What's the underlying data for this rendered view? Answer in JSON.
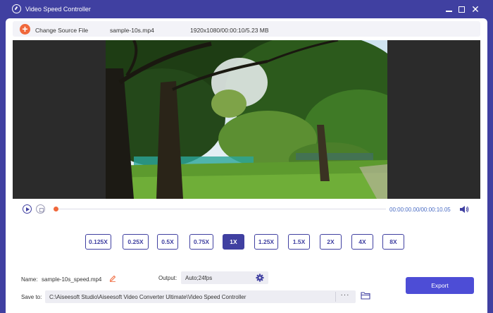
{
  "window": {
    "title": "Video Speed Controller",
    "icons": {
      "app": "speedometer-icon",
      "minimize": "minimize-icon",
      "maximize": "maximize-icon",
      "close": "close-icon"
    },
    "close_glyph": "✕"
  },
  "toolbar": {
    "add_glyph": "+",
    "change_source_label": "Change Source File",
    "file_name": "sample-10s.mp4",
    "file_info": "1920x1080/00:00:10/5.23 MB"
  },
  "player": {
    "time": "00:00:00.00/00:00:10.05",
    "progress": 0,
    "icons": {
      "play": "play-icon",
      "stop": "stop-icon",
      "volume": "volume-icon"
    }
  },
  "speeds": {
    "options": [
      "0.125X",
      "0.25X",
      "0.5X",
      "0.75X",
      "1X",
      "1.25X",
      "1.5X",
      "2X",
      "4X",
      "8X"
    ],
    "selected": "1X"
  },
  "settings": {
    "name_label": "Name:",
    "name_value": "sample-10s_speed.mp4",
    "output_label": "Output:",
    "output_value": "Auto;24fps",
    "save_label": "Save to:",
    "save_path": "C:\\Aiseesoft Studio\\Aiseesoft Video Converter Ultimate\\Video Speed Controller",
    "more_glyph": "···",
    "export_label": "Export"
  },
  "colors": {
    "accent": "#4040a1",
    "export": "#4d4dd6",
    "orange": "#f0683b",
    "time_text": "#4a6cc4"
  }
}
